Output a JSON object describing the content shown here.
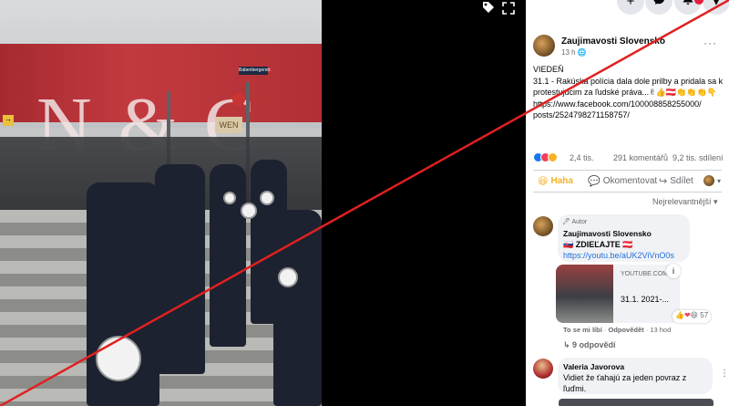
{
  "viewer": {
    "photo_store_sign": "N & C",
    "photo_street_sign": "Babenbergerstr.",
    "photo_shop_sign": "WEN",
    "photo_small_sign": "→"
  },
  "topbar": {
    "icons": [
      "plus-icon",
      "messenger-icon",
      "bell-icon",
      "account-icon"
    ],
    "plus_glyph": "+",
    "messenger_glyph": "✉",
    "bell_glyph": "🔔",
    "account_glyph": "▾"
  },
  "post": {
    "author": "Zaujimavosti Slovensko",
    "time": "13 h",
    "more_glyph": "···",
    "text_line1": "VIEDEŇ",
    "text_line2": "31.1 - Rakúska polícia dala dole prilby a pridala sa k protestujúcim za ľudské práva...✌👍🇦🇹👏👏👏👇",
    "url_line1": "https://www.facebook.com/100008858255000/",
    "url_line2": "posts/2524798271158757/",
    "reaction_count": "2,4 tis.",
    "comment_count": "291 komentářů",
    "share_count": "9,2 tis. sdílení",
    "actions": {
      "haha": "Haha",
      "comment": "Okomentovat",
      "share": "Sdílet"
    },
    "sort_label": "Nejrelevantnější ▾"
  },
  "comments": [
    {
      "badge": "Autor",
      "author": "Zaujimavosti Slovensko",
      "text": "🇸🇰 ZDIEĽAJTE 🇦🇹",
      "link": "https://youtu.be/aUK2ViVnO0s",
      "preview_domain": "YOUTUBE.COM",
      "preview_title": "31.1. 2021-...",
      "reaction_count": "57",
      "like_label": "To se mi líbí",
      "reply_label": "Odpovědět",
      "time": "13 hod",
      "replies": "↳ 9 odpovědí"
    },
    {
      "author": "Valeria Javorova",
      "text": "Vidiet že ťahajú za jeden povraz z ľuďmi."
    }
  ],
  "colors": {
    "facebook_blue": "#216fdb",
    "haha_yellow": "#f7b125",
    "overlay_red": "#e02020",
    "panel_bg": "#ffffff",
    "bubble_bg": "#f0f2f5"
  }
}
